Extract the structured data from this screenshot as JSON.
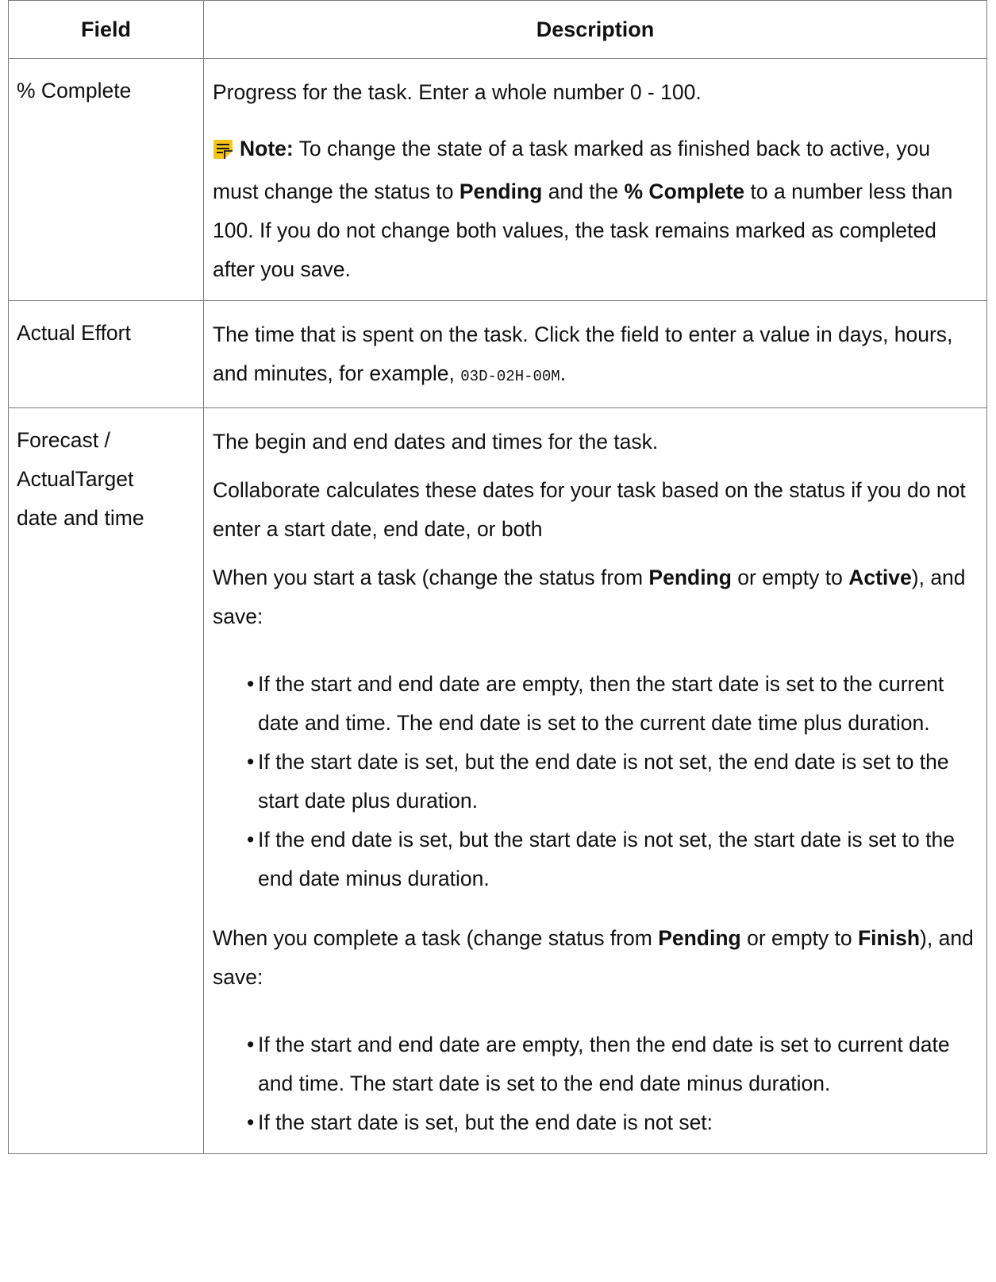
{
  "table": {
    "headers": {
      "field": "Field",
      "description": "Description"
    },
    "rows": {
      "complete": {
        "field": "% Complete",
        "desc": "Progress for the task. Enter a whole number 0 - 100.",
        "note_label": "Note:",
        "note_t1": " To change the state of a task marked as finished back to active, you must change the status to ",
        "note_b1": "Pending",
        "note_t2": " and the ",
        "note_b2": "% Complete",
        "note_t3": " to a number less than 100. If you do not change both values, the task remains marked as completed after you save."
      },
      "effort": {
        "field": "Actual Effort",
        "desc": "The time that is spent on the task. Click the field to enter a value in days, hours, and minutes, for example, ",
        "code": "03D-02H-00M",
        "desc_end": "."
      },
      "forecast": {
        "field_lines": [
          "Forecast /",
          "ActualTarget",
          "date and time"
        ],
        "p1": "The begin and end dates and times for the task.",
        "p2": "Collaborate calculates these dates for your task based on the status if you do not enter a start date, end date, or both",
        "start_t1": "When you start a task (change the status from ",
        "start_b1": "Pending",
        "start_t2": " or empty to ",
        "start_b2": "Active",
        "start_t3": "), and save:",
        "start_items": [
          "If the start and end date are empty, then the start date is set to the current date and time. The end date is set to the current date time plus duration.",
          "If the start date is set, but the end date is not set, the end date is set to the start date plus duration.",
          "If the end date is set, but the start date is not set, the start date is set to the end date minus duration."
        ],
        "complete_t1": "When you complete a task (change status from ",
        "complete_b1": "Pending",
        "complete_t2": " or empty to ",
        "complete_b2": "Finish",
        "complete_t3": "), and save:",
        "complete_items": [
          "If the start and end date are empty, then the end date is set to current date and time. The start date is set to the end date minus duration.",
          "If the start date is set, but the end date is not set:"
        ],
        "bullet": "•"
      }
    }
  },
  "colors": {
    "note_icon": "#f5c518",
    "border": "#7a7a7a",
    "text": "#111111"
  },
  "icons": {
    "note": "note-icon"
  }
}
